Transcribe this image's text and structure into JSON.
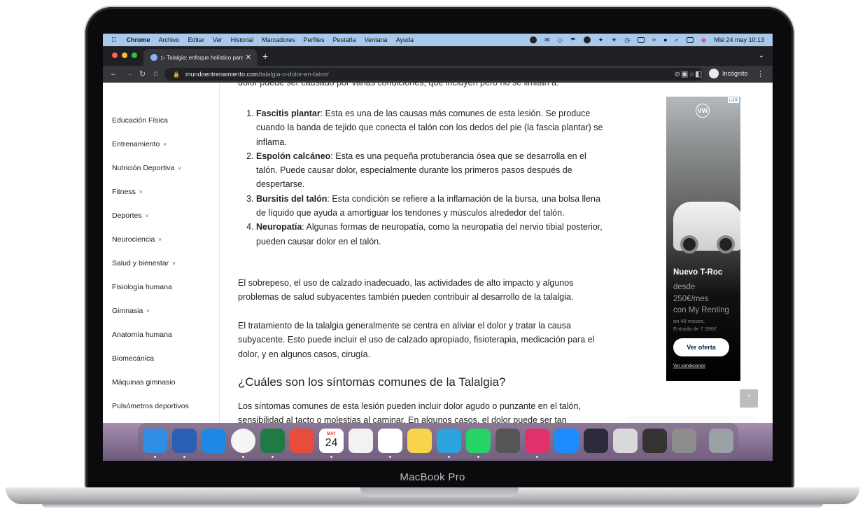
{
  "device": {
    "label": "MacBook Pro"
  },
  "menubar": {
    "app": "Chrome",
    "items": [
      "Archivo",
      "Editar",
      "Ver",
      "Historial",
      "Marcadores",
      "Perfiles",
      "Pestaña",
      "Ventana",
      "Ayuda"
    ],
    "clock": "Mié 24 may 10:13"
  },
  "browser": {
    "tab_title": "▷ Talalgia: enfoque holístico para...",
    "url_domain": "mundoentrenamiento.com",
    "url_path": "/talalgia-o-dolor-en-talon/",
    "profile": "Incógnito"
  },
  "sidebar": {
    "items": [
      {
        "label": "Educación Física",
        "has_sub": false
      },
      {
        "label": "Entrenamiento",
        "has_sub": true
      },
      {
        "label": "Nutrición Deportiva",
        "has_sub": true
      },
      {
        "label": "Fitness",
        "has_sub": true
      },
      {
        "label": "Deportes",
        "has_sub": true
      },
      {
        "label": "Neurociencia",
        "has_sub": true
      },
      {
        "label": "Salud y bienestar",
        "has_sub": true
      },
      {
        "label": "Fisiología humana",
        "has_sub": false
      },
      {
        "label": "Gimnasia",
        "has_sub": true
      },
      {
        "label": "Anatomía humana",
        "has_sub": false
      },
      {
        "label": "Biomecánica",
        "has_sub": false
      },
      {
        "label": "Máquinas gimnasio",
        "has_sub": false
      },
      {
        "label": "Pulsómetros deportivos",
        "has_sub": false
      }
    ]
  },
  "article": {
    "cut_line": "dolor puede ser causado por varias condiciones, que incluyen pero no se limitan a:",
    "causes": [
      {
        "term": "Fascitis plantar",
        "text": ": Esta es una de las causas más comunes de esta lesión. Se produce cuando la banda de tejido que conecta el talón con los dedos del pie (la fascia plantar) se inflama."
      },
      {
        "term": "Espolón calcáneo",
        "text": ": Esta es una pequeña protuberancia ósea que se desarrolla en el talón. Puede causar dolor, especialmente durante los primeros pasos después de despertarse."
      },
      {
        "term": "Bursitis del talón",
        "text": ": Esta condición se refiere a la inflamación de la bursa, una bolsa llena de líquido que ayuda a amortiguar los tendones y músculos alrededor del talón."
      },
      {
        "term": "Neuropatía",
        "text": ": Algunas formas de neuropatía, como la neuropatía del nervio tibial posterior, pueden causar dolor en el talón."
      }
    ],
    "para1": "El sobrepeso, el uso de calzado inadecuado, las actividades de alto impacto y algunos problemas de salud subyacentes también pueden contribuir al desarrollo de la talalgia.",
    "para2": "El tratamiento de la talalgia generalmente se centra en aliviar el dolor y tratar la causa subyacente. Esto puede incluir el uso de calzado apropiado, fisioterapia, medicación para el dolor, y en algunos casos, cirugía.",
    "heading": "¿Cuáles son los síntomas comunes de la Talalgia?",
    "para3": "Los síntomas comunes de esta lesión pueden incluir dolor agudo o punzante en el talón, sensibilidad al tacto o molestias al caminar. En algunos casos, el dolor puede ser tan"
  },
  "ad": {
    "adchoices": "▷|X",
    "brand": "VW",
    "title": "Nuevo T-Roc",
    "price_lines": [
      "desde",
      "250€/mes",
      "con My Renting"
    ],
    "small_lines": [
      "en 48 meses.",
      "Entrada de 7.596€"
    ],
    "cta": "Ver oferta",
    "conditions": "Ver condiciones"
  },
  "dock": {
    "calendar_month": "MAY",
    "calendar_day": "24",
    "apps": [
      {
        "name": "finder",
        "color": "#2f8de4"
      },
      {
        "name": "word",
        "color": "#2b5fb4"
      },
      {
        "name": "safari",
        "color": "#1e88e5"
      },
      {
        "name": "chrome",
        "color": "#f5f5f5"
      },
      {
        "name": "excel",
        "color": "#1f7a45"
      },
      {
        "name": "mail",
        "color": "#e74c3c"
      },
      {
        "name": "calendar",
        "color": "#ffffff"
      },
      {
        "name": "reminders",
        "color": "#f2f2f2"
      },
      {
        "name": "slack",
        "color": "#ffffff"
      },
      {
        "name": "notes",
        "color": "#f7d44a"
      },
      {
        "name": "telegram",
        "color": "#2aa3df"
      },
      {
        "name": "whatsapp",
        "color": "#25d366"
      },
      {
        "name": "speed",
        "color": "#555"
      },
      {
        "name": "instagram",
        "color": "#e1306c"
      },
      {
        "name": "messages",
        "color": "#1a8cff"
      },
      {
        "name": "davinci",
        "color": "#2b2b3b"
      },
      {
        "name": "launchpad",
        "color": "#d9d9d9"
      },
      {
        "name": "quicktime",
        "color": "#333"
      },
      {
        "name": "system-settings",
        "color": "#8d8d8d"
      },
      {
        "name": "trash",
        "color": "#9ba0a5"
      }
    ]
  }
}
